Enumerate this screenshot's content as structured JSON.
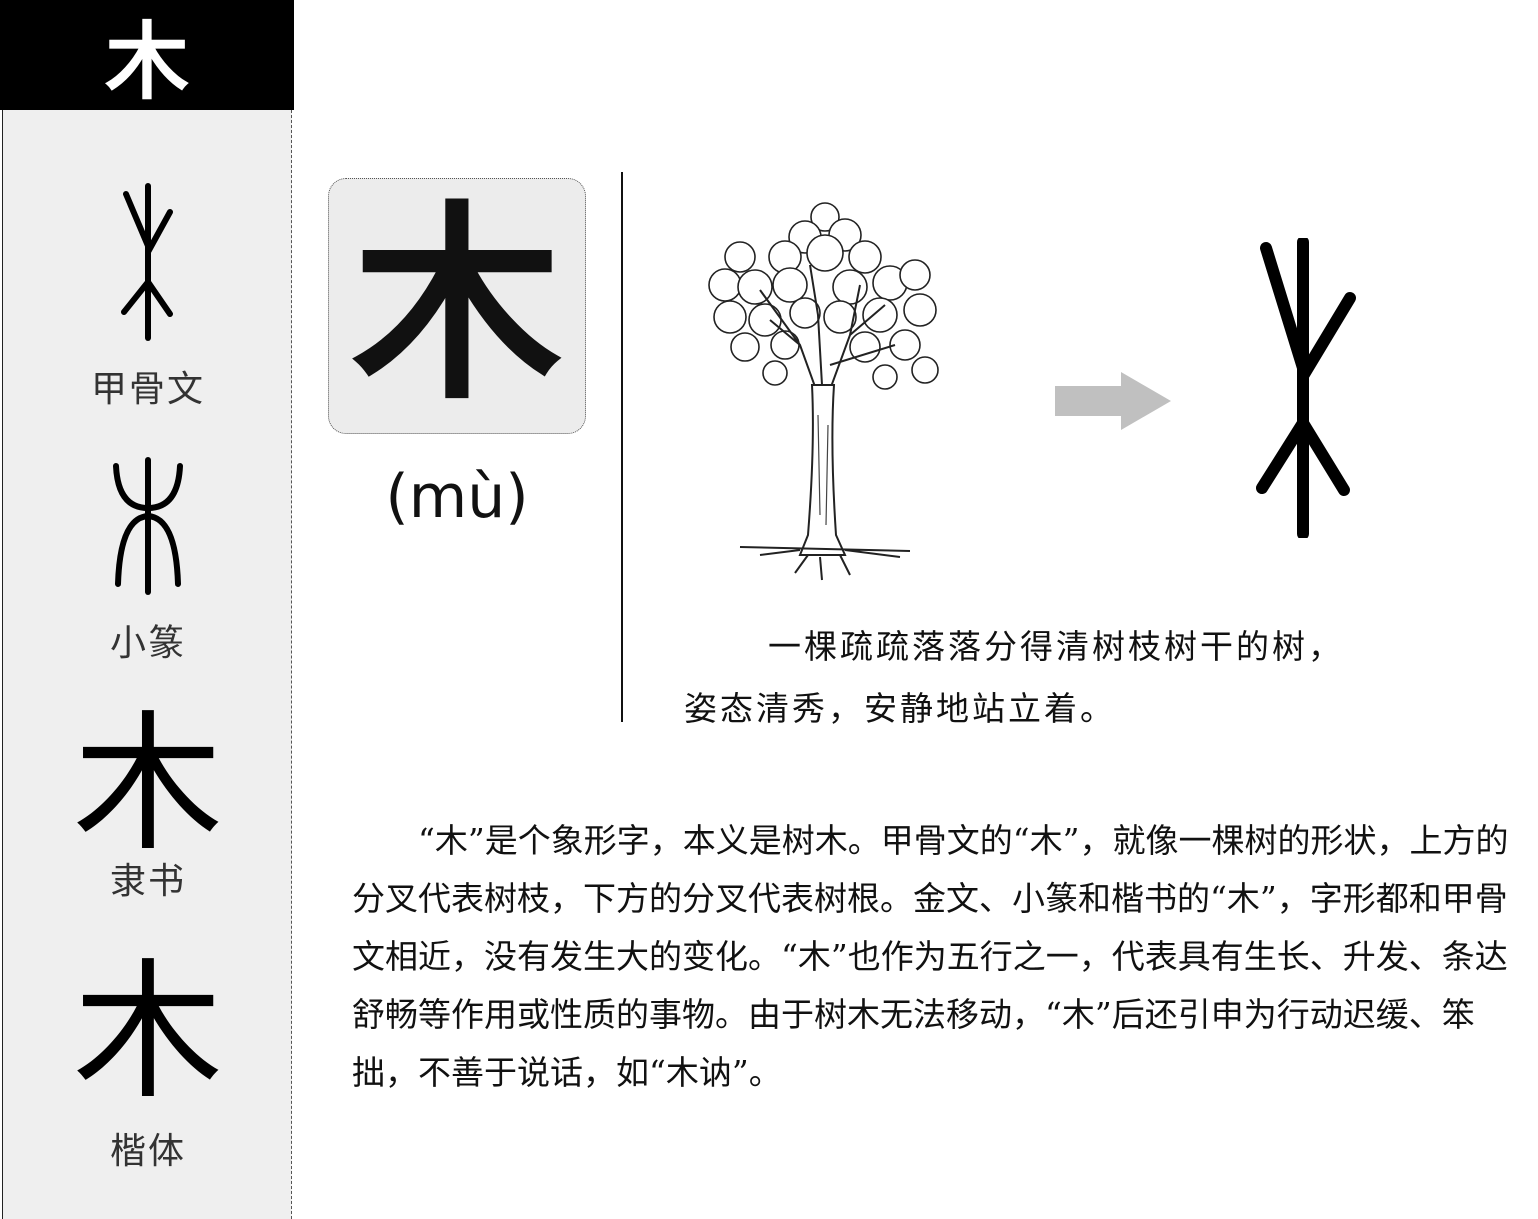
{
  "header": {
    "character": "木"
  },
  "sidebar": {
    "items": [
      {
        "label": "甲骨文"
      },
      {
        "label": "小篆"
      },
      {
        "label": "隶书",
        "glyph": "木"
      },
      {
        "label": "楷体",
        "glyph": "木"
      }
    ]
  },
  "main": {
    "character": "木",
    "pinyin": "(mù)",
    "caption_line1": "一棵疏疏落落分得清树枝树干的树，",
    "caption_line2": "姿态清秀，安静地站立着。",
    "description": "“木”是个象形字，本义是树木。甲骨文的“木”，就像一棵树的形状，上方的分叉代表树枝，下方的分叉代表树根。金文、小篆和楷书的“木”，字形都和甲骨文相近，没有发生大的变化。“木”也作为五行之一，代表具有生长、升发、条达舒畅等作用或性质的事物。由于树木无法移动，“木”后还引申为行动迟缓、笨拙，不善于说话，如“木讷”。"
  },
  "colors": {
    "header_bg": "#000000",
    "sidebar_bg": "#efefef",
    "char_box_bg": "#ececec",
    "arrow": "#c0c0c0"
  }
}
